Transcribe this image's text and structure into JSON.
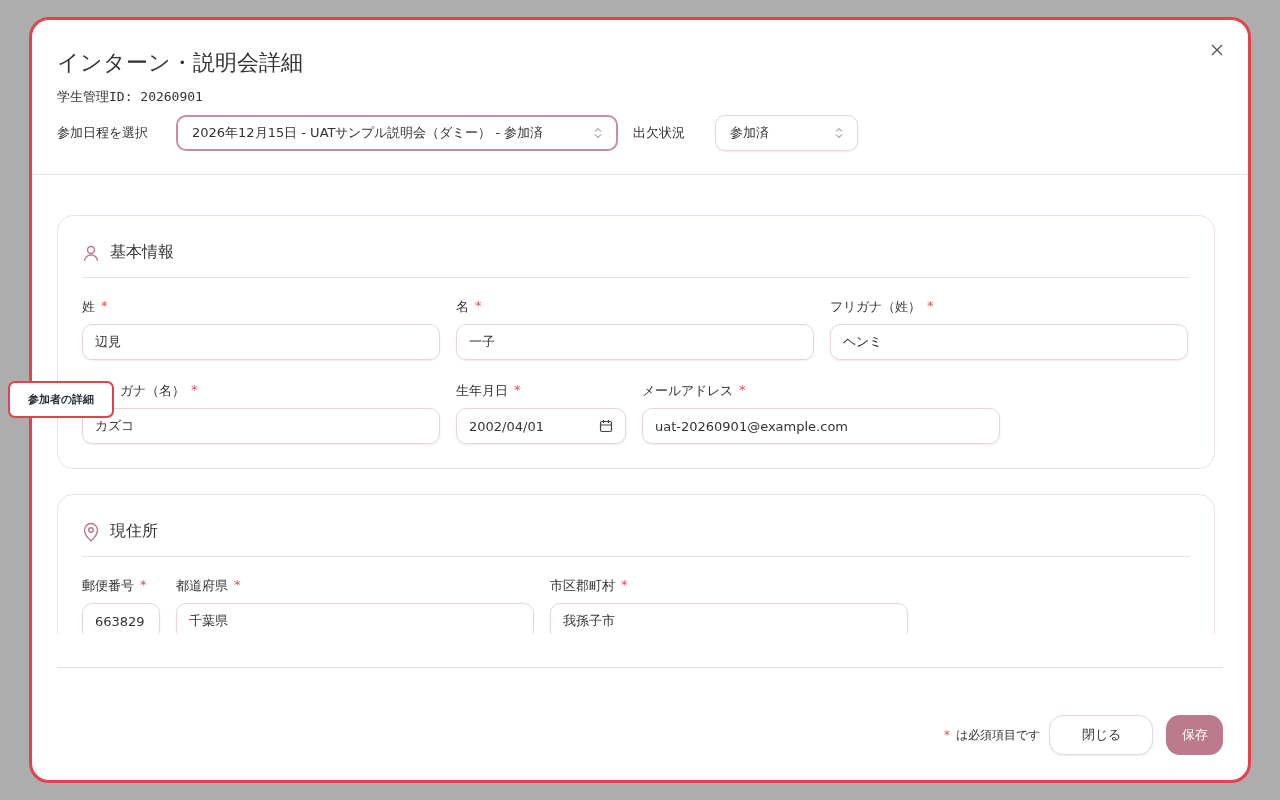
{
  "tooltip": {
    "text": "参加者の詳細"
  },
  "dialog": {
    "title": "インターン・説明会詳細",
    "student_id": "学生管理ID: 20260901",
    "schedule": {
      "label": "参加日程を選択",
      "value": "2026年12月15日 - UATサンプル説明会（ダミー） - 参加済"
    },
    "attendance": {
      "label": "出欠状況",
      "value": "参加済"
    },
    "required_mark": "*",
    "sections": [
      {
        "title": "基本情報",
        "fields": [
          {
            "label": "姓",
            "required": true,
            "value": "辺見",
            "kind": "text"
          },
          {
            "label": "名",
            "required": true,
            "value": "一子",
            "kind": "text"
          },
          {
            "label": "フリガナ（姓）",
            "required": true,
            "value": "ヘンミ",
            "kind": "text"
          },
          {
            "label": "ガナ（名）",
            "required": true,
            "value": "カズコ",
            "kind": "text",
            "partly_hidden": true
          },
          {
            "label": "生年月日",
            "required": true,
            "value": "2002/04/01",
            "kind": "date"
          },
          {
            "label": "メールアドレス",
            "required": true,
            "value": "uat-20260901@example.com",
            "kind": "text"
          }
        ]
      },
      {
        "title": "現住所",
        "fields": [
          {
            "label": "郵便番号",
            "required": true,
            "value": "663829",
            "kind": "short"
          },
          {
            "label": "都道府県",
            "required": true,
            "value": "千葉県",
            "kind": "text"
          },
          {
            "label": "市区郡町村",
            "required": true,
            "value": "我孫子市",
            "kind": "text"
          }
        ]
      }
    ],
    "legend": {
      "mark": "*",
      "text": "は必須項目です"
    },
    "buttons": [
      {
        "label": "閉じる",
        "kind": "secondary"
      },
      {
        "label": "保存",
        "kind": "primary"
      }
    ]
  }
}
